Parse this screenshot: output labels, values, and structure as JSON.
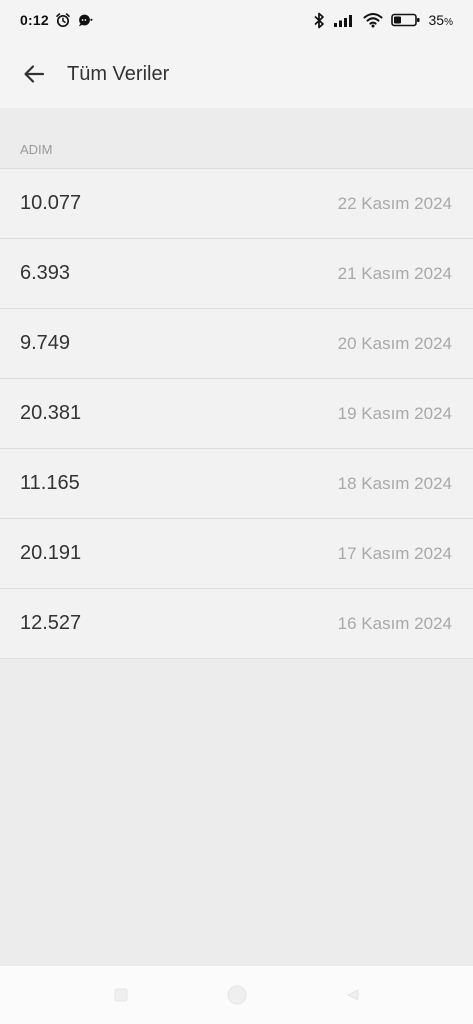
{
  "status_bar": {
    "time": "0:12",
    "battery_percent": "35",
    "battery_suffix": "%",
    "battery_level": 0.35,
    "icons": [
      "alarm-icon",
      "chat-bubble-icon",
      "bluetooth-icon",
      "signal-icon",
      "wifi-icon",
      "battery-icon"
    ]
  },
  "header": {
    "title": "Tüm Veriler",
    "back_icon": "arrow-left-icon"
  },
  "section": {
    "label": "ADIM"
  },
  "items": [
    {
      "value": "10.077",
      "date": "22 Kasım 2024"
    },
    {
      "value": "6.393",
      "date": "21 Kasım 2024"
    },
    {
      "value": "9.749",
      "date": "20 Kasım 2024"
    },
    {
      "value": "20.381",
      "date": "19 Kasım 2024"
    },
    {
      "value": "11.165",
      "date": "18 Kasım 2024"
    },
    {
      "value": "20.191",
      "date": "17 Kasım 2024"
    },
    {
      "value": "12.527",
      "date": "16 Kasım 2024"
    }
  ],
  "nav_bar": {
    "icons": [
      "recents-icon",
      "home-icon",
      "back-nav-icon"
    ]
  },
  "colors": {
    "background": "#ececec",
    "surface": "#f2f2f2",
    "primary_text": "#333333",
    "secondary_text": "#a9a9a9"
  }
}
